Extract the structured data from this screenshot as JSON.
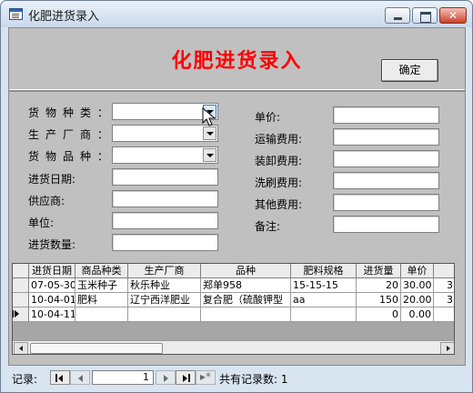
{
  "window": {
    "title": "化肥进货录入"
  },
  "header": {
    "title": "化肥进货录入",
    "confirm_label": "确定"
  },
  "fields": {
    "category_label": "货物种类：",
    "manufacturer_label": "生产厂商：",
    "variety_label": "货物品种：",
    "date_label": "进货日期:",
    "supplier_label": "供应商:",
    "unit_label": "单位:",
    "quantity_label": "进货数量:",
    "price_label": "单价:",
    "freight_label": "运输费用:",
    "handling_label": "装卸费用:",
    "washing_label": "洗刷费用:",
    "other_label": "其他费用:",
    "remarks_label": "备注:"
  },
  "grid": {
    "columns": [
      "进货日期",
      "商品种类",
      "生产厂商",
      "品种",
      "肥料规格",
      "进货量",
      "单价",
      ""
    ],
    "rows": [
      [
        "07-05-30",
        "玉米种子",
        "秋乐种业",
        "郑单958",
        "15-15-15",
        "20",
        "30.00",
        "3"
      ],
      [
        "10-04-01",
        "肥料",
        "辽宁西洋肥业",
        "复合肥（硫酸钾型",
        "aa",
        "150",
        "20.00",
        "3"
      ],
      [
        "10-04-11",
        "",
        "",
        "",
        "",
        "0",
        "0.00",
        ""
      ]
    ]
  },
  "navigator": {
    "record_label": "记录:",
    "current_record": "1",
    "total_label": "共有记录数: 1"
  },
  "icons": {
    "window": "form-window-icon",
    "dropdown": "chevron-down-icon",
    "cursor": "mouse-pointer-icon"
  },
  "colors": {
    "title": "#ff0000",
    "form_bg": "#c0c0c0",
    "window_bg": "#d8e4f0"
  }
}
